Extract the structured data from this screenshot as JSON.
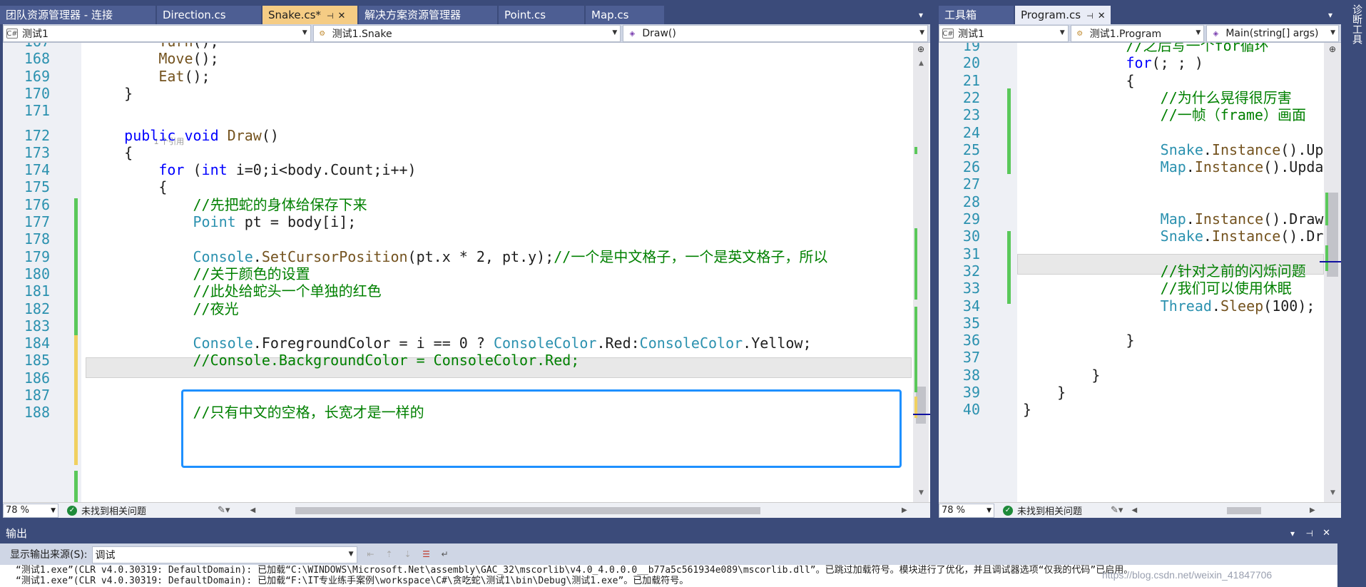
{
  "left_tabs": [
    {
      "label": "团队资源管理器 - 连接"
    },
    {
      "label": "Direction.cs"
    },
    {
      "label": "Snake.cs*",
      "active": true
    },
    {
      "label": "解决方案资源管理器"
    },
    {
      "label": "Point.cs"
    },
    {
      "label": "Map.cs"
    }
  ],
  "right_tabs": [
    {
      "label": "工具箱"
    },
    {
      "label": "Program.cs",
      "active": true
    }
  ],
  "left_nav": {
    "project": "测试1",
    "class": "测试1.Snake",
    "member": "Draw()"
  },
  "right_nav": {
    "project": "测试1",
    "class": "测试1.Program",
    "member": "Main(string[] args)"
  },
  "left_editor": {
    "codelens": "1 个引用",
    "lines": [
      {
        "n": "167",
        "t": [
          [
            "tx",
            "        "
          ],
          [
            "mt",
            "Turn"
          ],
          [
            "tx",
            "();"
          ]
        ]
      },
      {
        "n": "168",
        "t": [
          [
            "tx",
            "        "
          ],
          [
            "mt",
            "Move"
          ],
          [
            "tx",
            "();"
          ]
        ]
      },
      {
        "n": "169",
        "t": [
          [
            "tx",
            "        "
          ],
          [
            "mt",
            "Eat"
          ],
          [
            "tx",
            "();"
          ]
        ]
      },
      {
        "n": "170",
        "t": [
          [
            "tx",
            "    }"
          ]
        ]
      },
      {
        "n": "171",
        "t": [
          [
            "tx",
            ""
          ]
        ]
      },
      {
        "n": "172",
        "t": [
          [
            "tx",
            "    "
          ],
          [
            "kw",
            "public void "
          ],
          [
            "mt",
            "Draw"
          ],
          [
            "tx",
            "()"
          ]
        ]
      },
      {
        "n": "173",
        "t": [
          [
            "tx",
            "    {"
          ]
        ]
      },
      {
        "n": "174",
        "t": [
          [
            "tx",
            "        "
          ],
          [
            "kw",
            "for "
          ],
          [
            "tx",
            "("
          ],
          [
            "kw",
            "int "
          ],
          [
            "tx",
            "i=0;i<body.Count;i++)"
          ]
        ]
      },
      {
        "n": "175",
        "t": [
          [
            "tx",
            "        {"
          ]
        ]
      },
      {
        "n": "176",
        "t": [
          [
            "tx",
            "            "
          ],
          [
            "cm",
            "//先把蛇的身体给保存下来"
          ]
        ]
      },
      {
        "n": "177",
        "t": [
          [
            "tx",
            "            "
          ],
          [
            "ty",
            "Point "
          ],
          [
            "tx",
            "pt = body[i];"
          ]
        ]
      },
      {
        "n": "178",
        "t": [
          [
            "tx",
            ""
          ]
        ]
      },
      {
        "n": "179",
        "t": [
          [
            "tx",
            "            "
          ],
          [
            "ty",
            "Console"
          ],
          [
            "tx",
            "."
          ],
          [
            "mt",
            "SetCursorPosition"
          ],
          [
            "tx",
            "(pt.x * 2, pt.y);"
          ],
          [
            "cm",
            "//一个是中文格子，一个是英文格子，所以"
          ]
        ]
      },
      {
        "n": "180",
        "t": [
          [
            "tx",
            "            "
          ],
          [
            "cm",
            "//关于颜色的设置"
          ]
        ]
      },
      {
        "n": "181",
        "t": [
          [
            "tx",
            "            "
          ],
          [
            "cm",
            "//此处给蛇头一个单独的红色"
          ]
        ]
      },
      {
        "n": "182",
        "t": [
          [
            "tx",
            "            "
          ],
          [
            "cm",
            "//夜光"
          ]
        ]
      },
      {
        "n": "183",
        "t": [
          [
            "tx",
            ""
          ]
        ]
      },
      {
        "n": "184",
        "t": [
          [
            "tx",
            "            "
          ],
          [
            "ty",
            "Console"
          ],
          [
            "tx",
            ".ForegroundColor = i == 0 ? "
          ],
          [
            "ty",
            "ConsoleColor"
          ],
          [
            "tx",
            ".Red:"
          ],
          [
            "ty",
            "ConsoleColor"
          ],
          [
            "tx",
            ".Yellow;"
          ]
        ]
      },
      {
        "n": "185",
        "t": [
          [
            "tx",
            "            "
          ],
          [
            "cm",
            "//Console.BackgroundColor = ConsoleColor.Red;"
          ]
        ]
      },
      {
        "n": "186",
        "t": [
          [
            "tx",
            ""
          ]
        ]
      },
      {
        "n": "187",
        "t": [
          [
            "tx",
            ""
          ]
        ]
      },
      {
        "n": "188",
        "t": [
          [
            "tx",
            "            "
          ],
          [
            "cm",
            "//只有中文的空格，长宽才是一样的"
          ]
        ]
      }
    ]
  },
  "right_editor": {
    "lines": [
      {
        "n": "19",
        "t": [
          [
            "tx",
            "            "
          ],
          [
            "cm",
            "//之后写一个for循环"
          ]
        ]
      },
      {
        "n": "20",
        "t": [
          [
            "tx",
            "            "
          ],
          [
            "kw",
            "for"
          ],
          [
            "tx",
            "(; ; )"
          ]
        ]
      },
      {
        "n": "21",
        "t": [
          [
            "tx",
            "            {"
          ]
        ]
      },
      {
        "n": "22",
        "t": [
          [
            "tx",
            "                "
          ],
          [
            "cm",
            "//为什么晃得很厉害"
          ]
        ]
      },
      {
        "n": "23",
        "t": [
          [
            "tx",
            "                "
          ],
          [
            "cm",
            "//一帧（frame）画面"
          ]
        ]
      },
      {
        "n": "24",
        "t": [
          [
            "tx",
            ""
          ]
        ]
      },
      {
        "n": "25",
        "t": [
          [
            "tx",
            "                "
          ],
          [
            "ty",
            "Snake"
          ],
          [
            "tx",
            "."
          ],
          [
            "mt",
            "Instance"
          ],
          [
            "tx",
            "().Up"
          ]
        ]
      },
      {
        "n": "26",
        "t": [
          [
            "tx",
            "                "
          ],
          [
            "ty",
            "Map"
          ],
          [
            "tx",
            "."
          ],
          [
            "mt",
            "Instance"
          ],
          [
            "tx",
            "().Upda"
          ]
        ]
      },
      {
        "n": "27",
        "t": [
          [
            "tx",
            ""
          ]
        ]
      },
      {
        "n": "28",
        "t": [
          [
            "tx",
            ""
          ]
        ]
      },
      {
        "n": "29",
        "t": [
          [
            "tx",
            "                "
          ],
          [
            "ty",
            "Map"
          ],
          [
            "tx",
            "."
          ],
          [
            "mt",
            "Instance"
          ],
          [
            "tx",
            "().Draw"
          ]
        ]
      },
      {
        "n": "30",
        "t": [
          [
            "tx",
            "                "
          ],
          [
            "ty",
            "Snake"
          ],
          [
            "tx",
            "."
          ],
          [
            "mt",
            "Instance"
          ],
          [
            "tx",
            "().Dr"
          ]
        ]
      },
      {
        "n": "31",
        "t": [
          [
            "tx",
            ""
          ]
        ]
      },
      {
        "n": "32",
        "t": [
          [
            "tx",
            "                "
          ],
          [
            "cm",
            "//针对之前的闪烁问题"
          ]
        ]
      },
      {
        "n": "33",
        "t": [
          [
            "tx",
            "                "
          ],
          [
            "cm",
            "//我们可以使用休眠"
          ]
        ]
      },
      {
        "n": "34",
        "t": [
          [
            "tx",
            "                "
          ],
          [
            "ty",
            "Thread"
          ],
          [
            "tx",
            "."
          ],
          [
            "mt",
            "Sleep"
          ],
          [
            "tx",
            "(100);"
          ]
        ]
      },
      {
        "n": "35",
        "t": [
          [
            "tx",
            ""
          ]
        ]
      },
      {
        "n": "36",
        "t": [
          [
            "tx",
            "            }"
          ]
        ]
      },
      {
        "n": "37",
        "t": [
          [
            "tx",
            ""
          ]
        ]
      },
      {
        "n": "38",
        "t": [
          [
            "tx",
            "        }"
          ]
        ]
      },
      {
        "n": "39",
        "t": [
          [
            "tx",
            "    }"
          ]
        ]
      },
      {
        "n": "40",
        "t": [
          [
            "tx",
            "}"
          ]
        ]
      }
    ]
  },
  "status": {
    "zoom": "78 %",
    "issues": "未找到相关问题"
  },
  "output": {
    "title": "输出",
    "source_label": "显示输出来源(S):",
    "source_value": "调试",
    "lines": [
      "“测试1.exe”(CLR v4.0.30319: DefaultDomain): 已加载“C:\\WINDOWS\\Microsoft.Net\\assembly\\GAC_32\\mscorlib\\v4.0_4.0.0.0__b77a5c561934e089\\mscorlib.dll”。已跳过加载符号。模块进行了优化，并且调试器选项“仅我的代码”已启用。",
      "“测试1.exe”(CLR v4.0.30319: DefaultDomain): 已加载“F:\\IT专业练手案例\\workspace\\C#\\贪吃蛇\\测试1\\bin\\Debug\\测试1.exe”。已加载符号。"
    ],
    "watermark": "https://blog.csdn.net/weixin_41847706"
  },
  "side_panel": "诊断工具",
  "colors": {
    "accent_blue": "#1e90ff",
    "change_green": "#5ac85a",
    "change_yellow": "#f0d060"
  }
}
